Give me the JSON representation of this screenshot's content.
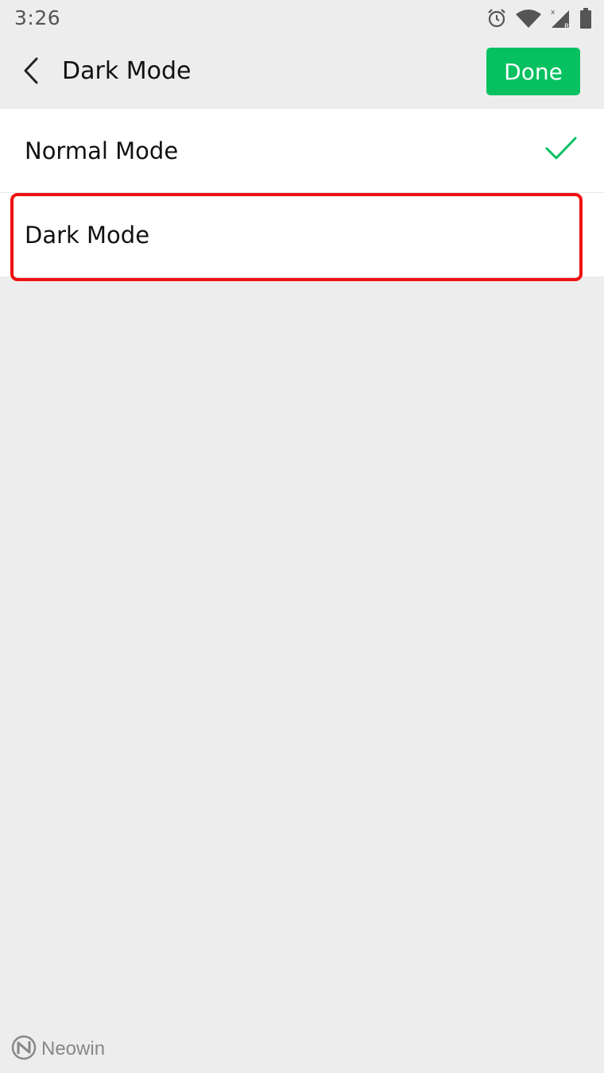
{
  "status_bar": {
    "time": "3:26",
    "icons": [
      "alarm-icon",
      "wifi-icon",
      "signal-icon",
      "battery-icon"
    ]
  },
  "nav": {
    "back_icon": "chevron-left-icon",
    "title": "Dark Mode",
    "done_label": "Done"
  },
  "options": [
    {
      "label": "Normal Mode",
      "selected": true
    },
    {
      "label": "Dark Mode",
      "selected": false,
      "highlighted": true
    }
  ],
  "watermark": {
    "text": "Neowin"
  },
  "colors": {
    "accent": "#07c160",
    "background": "#ededed",
    "highlight": "#ee1111"
  }
}
